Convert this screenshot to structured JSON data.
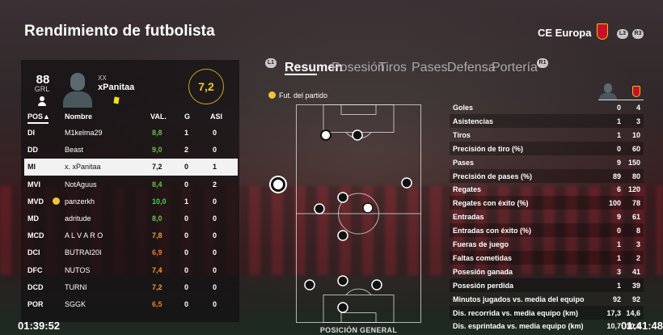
{
  "header": {
    "title": "Rendimiento de futbolista",
    "competition": "CE Europa",
    "hint_left": "L3",
    "hint_right": "R3"
  },
  "player_card": {
    "rating": "88",
    "rating_label": "GRL",
    "subtitle": "XX",
    "name": "xPanitaa",
    "match_rating": "7,2"
  },
  "table": {
    "headers": {
      "pos": "POS▲",
      "name": "Nombre",
      "val": "VAL.",
      "g": "G",
      "asi": "ASI"
    },
    "rows": [
      {
        "pos": "DI",
        "name": "M1kelma29",
        "val": "8,8",
        "g": "1",
        "asi": "0",
        "color": "#6cc04a"
      },
      {
        "pos": "DD",
        "name": "Beast",
        "val": "9,0",
        "g": "2",
        "asi": "0",
        "color": "#6cc04a"
      },
      {
        "pos": "MI",
        "name": "x. xPanitaa",
        "val": "7,2",
        "g": "0",
        "asi": "1",
        "color": "#111111",
        "selected": true
      },
      {
        "pos": "MVI",
        "name": "NotAguus",
        "val": "8,4",
        "g": "0",
        "asi": "2",
        "color": "#6cc04a"
      },
      {
        "pos": "MVD",
        "name": "panzerkh",
        "val": "10,0",
        "g": "1",
        "asi": "0",
        "color": "#3fd35a",
        "motm": true
      },
      {
        "pos": "MD",
        "name": "adritude",
        "val": "8,0",
        "g": "0",
        "asi": "0",
        "color": "#6cc04a"
      },
      {
        "pos": "MCD",
        "name": "A L V A R O",
        "val": "7,8",
        "g": "0",
        "asi": "0",
        "color": "#f0a030"
      },
      {
        "pos": "DCI",
        "name": "BUTRAI20I",
        "val": "6,9",
        "g": "0",
        "asi": "0",
        "color": "#f07a30"
      },
      {
        "pos": "DFC",
        "name": "NUTOS",
        "val": "7,4",
        "g": "0",
        "asi": "0",
        "color": "#f0a030"
      },
      {
        "pos": "DCD",
        "name": "TURNI",
        "val": "7,2",
        "g": "0",
        "asi": "0",
        "color": "#f0a030"
      },
      {
        "pos": "POR",
        "name": "SGGK",
        "val": "6,5",
        "g": "0",
        "asi": "0",
        "color": "#f07a30"
      }
    ]
  },
  "tabs": {
    "hint_left": "L1",
    "hint_right": "R1",
    "items": [
      "Resumen",
      "Posesión",
      "Tiros",
      "Pases",
      "Defensa",
      "Portería"
    ]
  },
  "pitch": {
    "motm_label": "Fut. del partido",
    "caption": "POSICIÓN GENERAL"
  },
  "stats": [
    {
      "label": "Goles",
      "player": "0",
      "team": "4"
    },
    {
      "label": "Asistencias",
      "player": "1",
      "team": "3"
    },
    {
      "label": "Tiros",
      "player": "1",
      "team": "10"
    },
    {
      "label": "Precisión de tiro (%)",
      "player": "0",
      "team": "60"
    },
    {
      "label": "Pases",
      "player": "9",
      "team": "150"
    },
    {
      "label": "Precisión de pases (%)",
      "player": "89",
      "team": "80"
    },
    {
      "label": "Regates",
      "player": "6",
      "team": "120"
    },
    {
      "label": "Regates con éxito (%)",
      "player": "100",
      "team": "78"
    },
    {
      "label": "Entradas",
      "player": "9",
      "team": "61"
    },
    {
      "label": "Entradas con éxito (%)",
      "player": "0",
      "team": "8"
    },
    {
      "label": "Fueras de juego",
      "player": "1",
      "team": "3"
    },
    {
      "label": "Faltas cometidas",
      "player": "1",
      "team": "2"
    },
    {
      "label": "Posesión ganada",
      "player": "3",
      "team": "41"
    },
    {
      "label": "Posesión perdida",
      "player": "1",
      "team": "39"
    },
    {
      "label": "Minutos jugados vs. media del equipo",
      "player": "92",
      "team": "92"
    },
    {
      "label": "Dis. recorrida vs. media equipo (km)",
      "player": "17,3",
      "team": "14,6"
    },
    {
      "label": "Dis. esprintada vs. media equipo (km)",
      "player": "10,7",
      "team": "10,1"
    }
  ],
  "clock": {
    "left": "01:39:52",
    "right": "01:41:48"
  }
}
